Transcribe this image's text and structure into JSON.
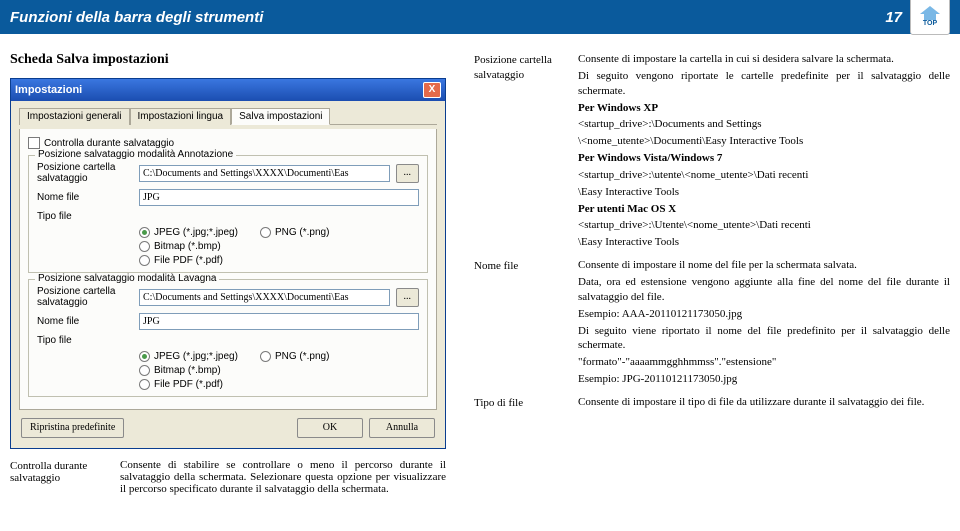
{
  "header": {
    "title": "Funzioni della barra degli strumenti",
    "page_no": "17",
    "badge_label": "TOP"
  },
  "left": {
    "section_title": "Scheda Salva impostazioni",
    "dialog": {
      "title": "Impostazioni",
      "close": "X",
      "tabs": [
        "Impostazioni generali",
        "Impostazioni lingua",
        "Salva impostazioni"
      ],
      "check_label": "Controlla durante salvataggio",
      "fieldset1_legend": "Posizione salvataggio modalità Annotazione",
      "fieldset2_legend": "Posizione salvataggio modalità Lavagna",
      "row_pos_label": "Posizione cartella salvataggio",
      "row_pos_value": "C:\\Documents and Settings\\XXXX\\Documenti\\Eas",
      "row_name_label": "Nome file",
      "row_name_value": "JPG",
      "row_type_label": "Tipo file",
      "radio_jpeg": "JPEG (*.jpg;*.jpeg)",
      "radio_png": "PNG (*.png)",
      "radio_bmp": "Bitmap (*.bmp)",
      "radio_pdf": "File PDF (*.pdf)",
      "btn_browse": "...",
      "btn_restore": "Ripristina predefinite",
      "btn_ok": "OK",
      "btn_cancel": "Annulla"
    },
    "table": {
      "row1_label": "Controlla durante salvataggio",
      "row1_text": "Consente di stabilire se controllare o meno il percorso durante il salvataggio della schermata. Selezionare questa opzione per visualizzare il percorso specificato durante il salvataggio della schermata."
    }
  },
  "right": {
    "row1_label": "Posizione cartella salvataggio",
    "row1_p1": "Consente di impostare la cartella in cui si desidera salvare la schermata.",
    "row1_p2": "Di seguito vengono riportate le cartelle predefinite per il salvataggio delle schermate.",
    "row1_xp_h": "Per Windows XP",
    "row1_xp_l1": "<startup_drive>:\\Documents and Settings",
    "row1_xp_l2": "\\<nome_utente>\\Documenti\\Easy Interactive Tools",
    "row1_w7_h": "Per Windows Vista/Windows 7",
    "row1_w7_l1": "<startup_drive>:\\utente\\<nome_utente>\\Dati recenti",
    "row1_w7_l2": "\\Easy Interactive Tools",
    "row1_mac_h": "Per utenti Mac OS X",
    "row1_mac_l1": "<startup_drive>:\\Utente\\<nome_utente>\\Dati recenti",
    "row1_mac_l2": "\\Easy Interactive Tools",
    "row2_label": "Nome file",
    "row2_p1": "Consente di impostare il nome del file per la schermata salvata.",
    "row2_p2": "Data, ora ed estensione vengono aggiunte alla fine del nome del file durante il salvataggio del file.",
    "row2_p3": "Esempio: AAA-20110121173050.jpg",
    "row2_p4": "Di seguito viene riportato il nome del file predefinito per il salvataggio delle schermate.",
    "row2_p5": "\"formato\"-\"aaaammgghhmmss\".\"estensione\"",
    "row2_p6": "Esempio: JPG-20110121173050.jpg",
    "row3_label": "Tipo di file",
    "row3_text": "Consente di impostare il tipo di file da utilizzare durante il salvataggio dei file."
  }
}
